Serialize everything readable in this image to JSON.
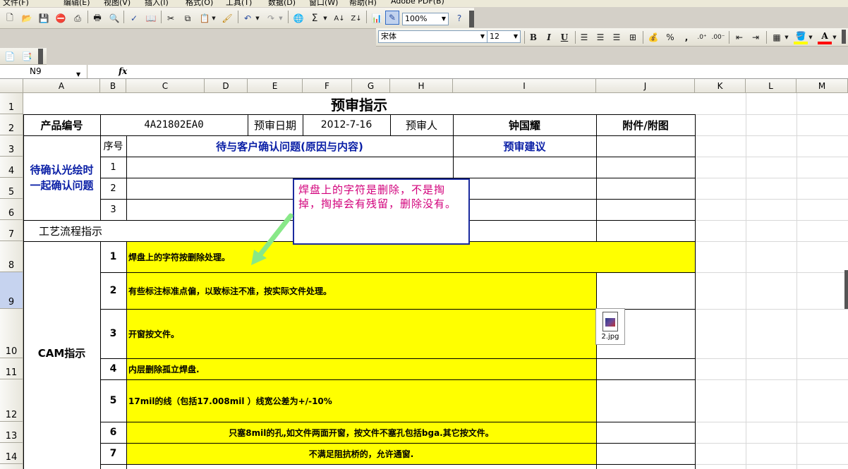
{
  "menu": [
    "文件(F)",
    "编辑(E)",
    "视图(V)",
    "插入(I)",
    "格式(O)",
    "工具(T)",
    "数据(D)",
    "窗口(W)",
    "帮助(H)",
    "Adobe PDF(B)"
  ],
  "toolbar": {
    "zoom": "100%",
    "font_name": "宋体",
    "font_size": "12",
    "bold": "B",
    "italic": "I",
    "underline": "U",
    "percent": "%",
    "comma": ",",
    "sigma": "Σ",
    "fx": "fx",
    "font_color_letter": "A"
  },
  "name_box": "N9",
  "columns": [
    "A",
    "B",
    "C",
    "D",
    "E",
    "F",
    "G",
    "H",
    "I",
    "J",
    "K",
    "L",
    "M"
  ],
  "rows": [
    "1",
    "2",
    "3",
    "4",
    "5",
    "6",
    "7",
    "8",
    "9",
    "10",
    "11",
    "12",
    "13",
    "14"
  ],
  "sheet": {
    "title": "预审指示",
    "product_no_label": "产品编号",
    "product_no": "4A21802EA0",
    "review_date_label": "预审日期",
    "review_date": "2012-7-16",
    "reviewer_label": "预审人",
    "reviewer": "钟国耀",
    "attachment_label": "附件/附图",
    "seq_label": "序号",
    "issues_label": "待与客户确认问题(原因与内容)",
    "suggestion_label": "预审建议",
    "confirm_label_1": "待确认光绘时",
    "confirm_label_2": "一起确认问题",
    "seq": [
      "1",
      "2",
      "3"
    ],
    "process_label": "工艺流程指示",
    "cam_label": "CAM指示",
    "cam_items": [
      {
        "no": "1",
        "text": "焊盘上的字符按删除处理。"
      },
      {
        "no": "2",
        "text": "有些标注标准点偏，以致标注不准，按实际文件处理。"
      },
      {
        "no": "3",
        "text": "开窗按文件。"
      },
      {
        "no": "4",
        "text": "内层删除孤立焊盘."
      },
      {
        "no": "5",
        "text": "17mil的线（包括17.008mil ）线宽公差为+/-10%"
      },
      {
        "no": "6",
        "text": "只塞8mil的孔,如文件两面开窗，按文件不塞孔包括bga.其它按文件。"
      },
      {
        "no": "7",
        "text": "不满足阻抗桥的，允许通窗."
      }
    ],
    "attachment_file": "2.jpg"
  },
  "callout": {
    "text": "焊盘上的字符是删除，不是掏掉，掏掉会有残留，删除没有。",
    "color": "#d2007b",
    "border_color": "#1a2a9e"
  },
  "colors": {
    "highlight": "#ffff00",
    "header_blue": "#0a1fa6",
    "arrow": "#88e888"
  }
}
